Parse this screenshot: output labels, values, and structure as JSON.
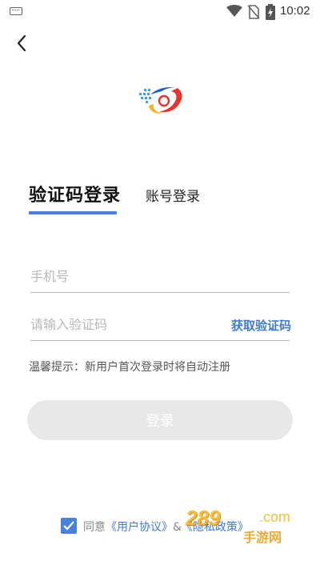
{
  "status_bar": {
    "time": "10:02",
    "icons": [
      "keyboard-icon",
      "wifi-icon",
      "no-sim-icon",
      "battery-charging-icon"
    ]
  },
  "header": {
    "back_icon": "chevron-left-icon"
  },
  "tabs": {
    "active_label": "验证码登录",
    "inactive_label": "账号登录"
  },
  "form": {
    "phone_placeholder": "手机号",
    "phone_value": "",
    "code_placeholder": "请输入验证码",
    "code_value": "",
    "get_code_label": "获取验证码",
    "hint": "温馨提示：新用户首次登录时将自动注册",
    "login_label": "登录"
  },
  "agreement": {
    "checked": true,
    "prefix": "同意",
    "user_agreement": "《用户协议》",
    "joiner": "&",
    "privacy_policy": "《隐私政策》"
  },
  "watermark": {
    "number": "289",
    "com": ".com",
    "cn": "手游网"
  },
  "colors": {
    "accent": "#4a7fe0",
    "link": "#3f7ad6",
    "button_disabled": "#e8e8e8"
  }
}
